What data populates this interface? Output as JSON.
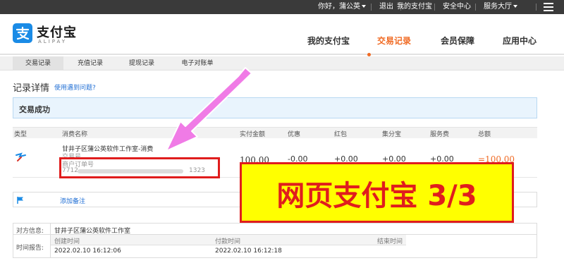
{
  "topbar": {
    "greeting": "你好，蒲公英",
    "logout": "退出",
    "my_alipay": "我的支付宝",
    "security": "安全中心",
    "service_hall": "服务大厅"
  },
  "header": {
    "logo_cn": "支付宝",
    "logo_en": "ALIPAY",
    "nav": [
      "我的支付宝",
      "交易记录",
      "会员保障",
      "应用中心"
    ],
    "active_nav": "交易记录",
    "accent_color": "#f06a23"
  },
  "subtabs": [
    "交易记录",
    "充值记录",
    "提现记录",
    "电子对账单"
  ],
  "record": {
    "title": "记录详情",
    "help_link": "使用遇到问题?",
    "status": "交易成功"
  },
  "table": {
    "headers": [
      "类型",
      "消费名称",
      "实付金额",
      "优惠",
      "红包",
      "集分宝",
      "服务费",
      "总额"
    ],
    "row": {
      "name": "甘井子区蒲公英软件工作室-消费",
      "trade_no_label": "交易号",
      "merchant_order_label": "商户订单号",
      "order_prefix": "7712",
      "order_suffix": "1323",
      "paid": "100.00",
      "discount": "-0.00",
      "redpacket": "+0.00",
      "points": "+0.00",
      "fee": "+0.00",
      "total": "=100.00"
    }
  },
  "note": {
    "add_note": "添加备注"
  },
  "info": {
    "counterparty_label": "对方信息:",
    "counterparty": "甘井子区蒲公英软件工作室",
    "time_label": "时间报告:",
    "created_label": "创建时间",
    "paid_label": "付款时间",
    "finished_label": "结束时间",
    "created": "2022.02.10 16:12:06",
    "paid_time": "2022.02.10 16:12:18"
  },
  "banner": {
    "text": "网页支付宝 3/3"
  }
}
